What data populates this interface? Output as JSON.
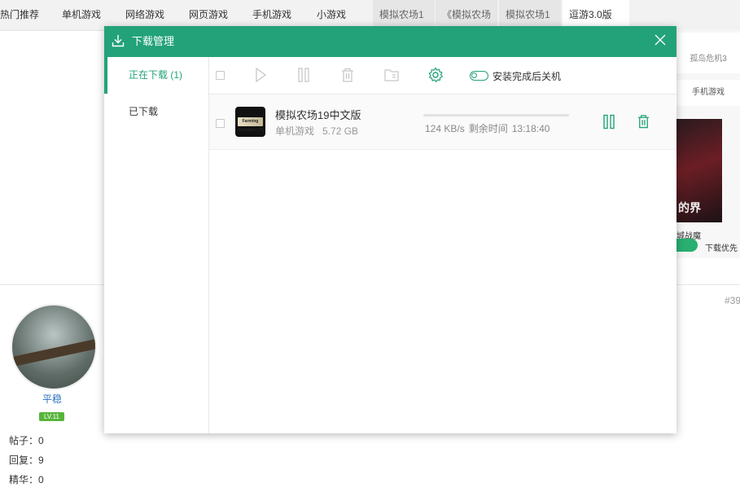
{
  "nav": {
    "items": [
      "热门推荐",
      "单机游戏",
      "网络游戏",
      "网页游戏",
      "手机游戏",
      "小游戏"
    ],
    "tabs": [
      "模拟农场1",
      "《模拟农场",
      "模拟农场1",
      "逗游3.0版"
    ]
  },
  "background": {
    "right_panel": {
      "item1": "孤岛危机3",
      "item2": "手机游戏",
      "poster_text": "的界",
      "caption": "城战魔",
      "toggle_label": "下载优先"
    },
    "post_number": "#39",
    "user": {
      "name": "平稳",
      "level": "LV.11",
      "stats": [
        "帖子：0",
        "回复：9",
        "精华：0"
      ]
    }
  },
  "dialog": {
    "title": "下载管理",
    "sidebar": {
      "downloading": "正在下载 (1)",
      "downloaded": "已下载"
    },
    "toolbar": {
      "auto_shutdown_label": "安装完成后关机"
    },
    "download": {
      "icon_text": "Farming Simulator 19",
      "name": "模拟农场19中文版",
      "category": "单机游戏",
      "size": "5.72 GB",
      "speed": "124 KB/s",
      "remaining_label": "剩余时间",
      "remaining_time": "13:18:40",
      "progress_fraction": 0.0
    },
    "colors": {
      "accent": "#23a27a"
    }
  }
}
